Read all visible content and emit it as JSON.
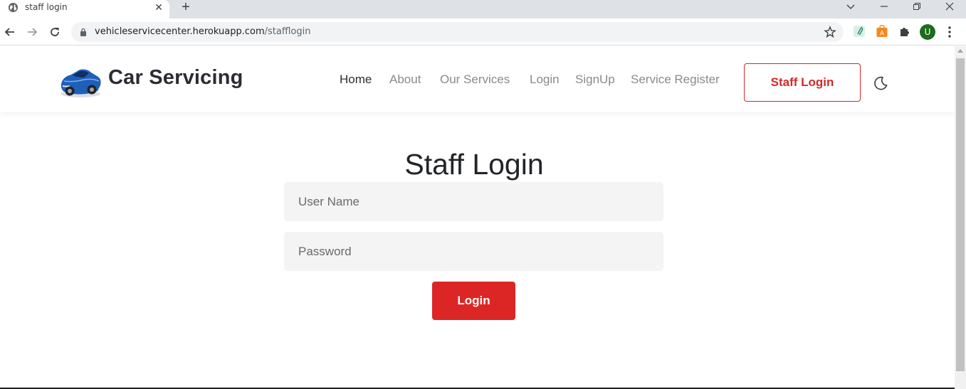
{
  "browser": {
    "tab_title": "staff login",
    "url_host": "vehicleservicecenter.herokuapp.com",
    "url_path": "/stafflogin",
    "profile_initial": "U",
    "accent_profile": "#1e6b1e"
  },
  "header": {
    "brand": "Car Servicing",
    "logo_icon": "blue-car-icon",
    "nav": {
      "home": "Home",
      "about": "About",
      "services": "Our Services",
      "login": "Login",
      "signup": "SignUp",
      "service_register": "Service Register"
    },
    "staff_login_button": "Staff Login",
    "theme_toggle_icon": "moon-icon"
  },
  "form": {
    "title": "Staff Login",
    "username_placeholder": "User Name",
    "password_placeholder": "Password",
    "submit_label": "Login"
  },
  "colors": {
    "accent_red": "#dc2626",
    "field_bg": "#f4f4f4"
  }
}
